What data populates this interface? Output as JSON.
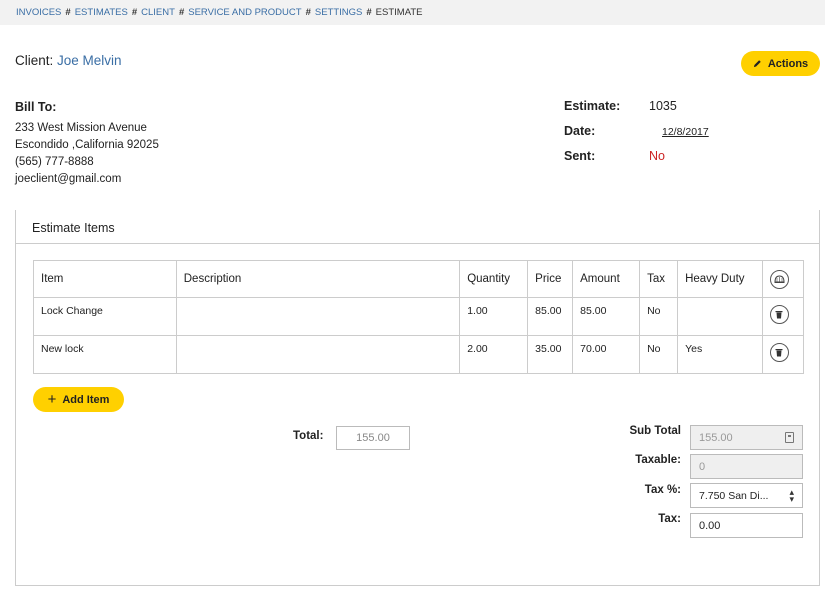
{
  "breadcrumb": {
    "items": [
      "INVOICES",
      "ESTIMATES",
      "CLIENT",
      "SERVICE AND PRODUCT",
      "SETTINGS"
    ],
    "separator": "#",
    "current": "ESTIMATE"
  },
  "client": {
    "label": "Client:",
    "name": "Joe Melvin"
  },
  "actions": {
    "label": "Actions",
    "icon": "pencil-icon"
  },
  "bill_to": {
    "header": "Bill To:",
    "address1": "233 West Mission Avenue",
    "address2": "Escondido ,California 92025",
    "phone": "(565) 777-8888",
    "email": "joeclient@gmail.com"
  },
  "meta": {
    "estimate_label": "Estimate:",
    "estimate_value": "1035",
    "date_label": "Date:",
    "date_value": "12/8/2017",
    "sent_label": "Sent:",
    "sent_value": "No",
    "sent_color": "#cc2222"
  },
  "panel": {
    "title": "Estimate Items"
  },
  "table": {
    "columns": [
      "Item",
      "Description",
      "Quantity",
      "Price",
      "Amount",
      "Tax",
      "Heavy Duty"
    ],
    "rows": [
      {
        "item": "Lock Change",
        "description": "",
        "quantity": "1.00",
        "price": "85.00",
        "amount": "85.00",
        "tax": "No",
        "heavy_duty": ""
      },
      {
        "item": "New lock",
        "description": "",
        "quantity": "2.00",
        "price": "35.00",
        "amount": "70.00",
        "tax": "No",
        "heavy_duty": "Yes"
      }
    ]
  },
  "add_item": {
    "label": "Add Item"
  },
  "totals": {
    "total_label": "Total:",
    "total_value": "155.00",
    "subtotal_label": "Sub Total",
    "subtotal_value": "155.00",
    "taxable_label": "Taxable:",
    "taxable_value": "0",
    "taxpct_label": "Tax %:",
    "taxpct_value": "7.750 San Di...",
    "tax_label": "Tax:",
    "tax_value": "0.00"
  },
  "colors": {
    "accent": "#ffd000",
    "link": "#3a6ea5"
  }
}
